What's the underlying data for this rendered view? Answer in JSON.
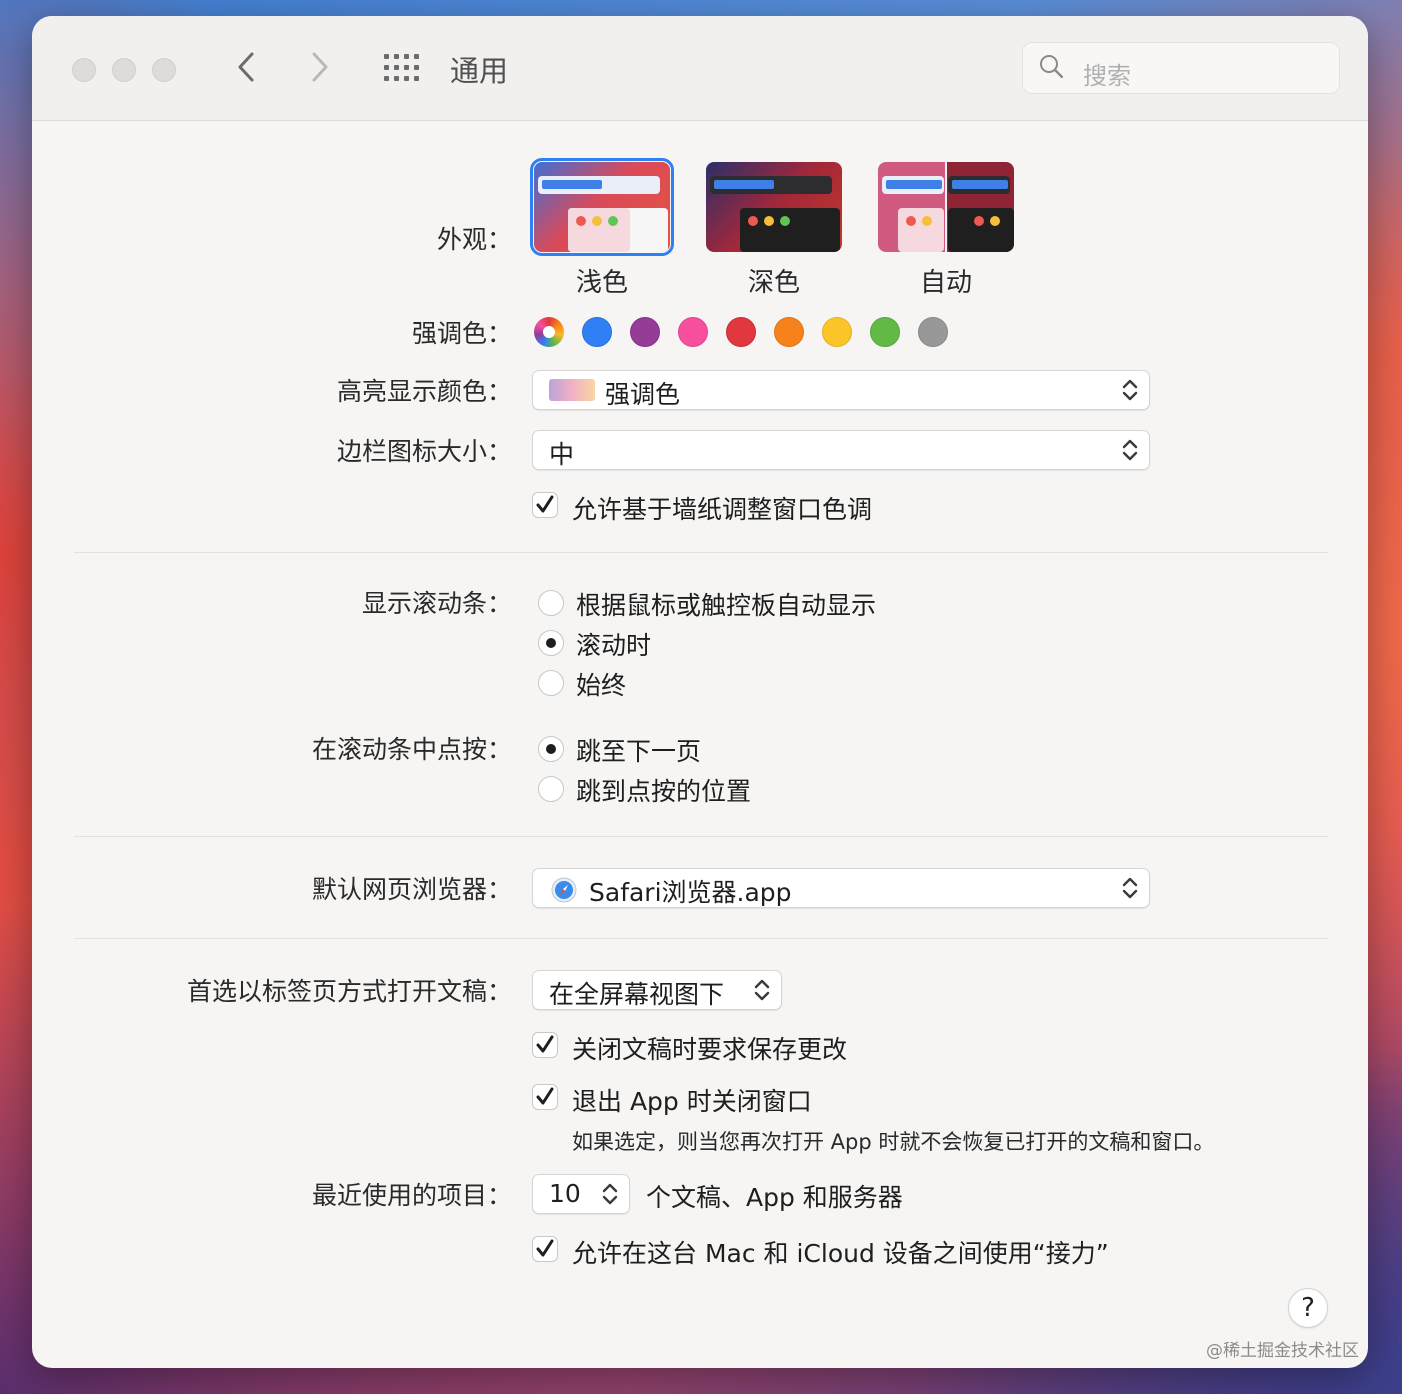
{
  "window": {
    "title": "通用",
    "search_placeholder": "搜索",
    "nav_back": "‹",
    "nav_forward": "›"
  },
  "appearance": {
    "label": "外观：",
    "options": [
      {
        "label": "浅色",
        "selected": true
      },
      {
        "label": "深色",
        "selected": false
      },
      {
        "label": "自动",
        "selected": false
      }
    ]
  },
  "accent_color": {
    "label": "强调色：",
    "colors": [
      "multicolor",
      "#2f7ff5",
      "#953d96",
      "#f74f9e",
      "#e0383e",
      "#f7821b",
      "#fcb827",
      "#62ba46",
      "#989898"
    ],
    "selected_index": 0
  },
  "highlight_color": {
    "label": "高亮显示颜色：",
    "value": "强调色"
  },
  "sidebar_icon_size": {
    "label": "边栏图标大小：",
    "value": "中"
  },
  "wallpaper_tinting": {
    "label": "允许基于墙纸调整窗口色调",
    "checked": true
  },
  "show_scroll_bars": {
    "label": "显示滚动条：",
    "options": [
      "根据鼠标或触控板自动显示",
      "滚动时",
      "始终"
    ],
    "selected_index": 1
  },
  "click_scroll_bar": {
    "label": "在滚动条中点按：",
    "options": [
      "跳至下一页",
      "跳到点按的位置"
    ],
    "selected_index": 0
  },
  "default_browser": {
    "label": "默认网页浏览器：",
    "value": "Safari浏览器.app"
  },
  "prefer_tabs": {
    "label": "首选以标签页方式打开文稿：",
    "value": "在全屏幕视图下"
  },
  "ask_keep_changes": {
    "label": "关闭文稿时要求保存更改",
    "checked": true
  },
  "close_windows": {
    "label": "退出 App 时关闭窗口",
    "checked": true,
    "note": "如果选定，则当您再次打开 App 时就不会恢复已打开的文稿和窗口。"
  },
  "recent_items": {
    "label": "最近使用的项目：",
    "value": "10",
    "suffix": "个文稿、App 和服务器"
  },
  "handoff": {
    "label": "允许在这台 Mac 和 iCloud 设备之间使用“接力”",
    "checked": true
  },
  "help_label": "?",
  "watermark": "@稀土掘金技术社区"
}
